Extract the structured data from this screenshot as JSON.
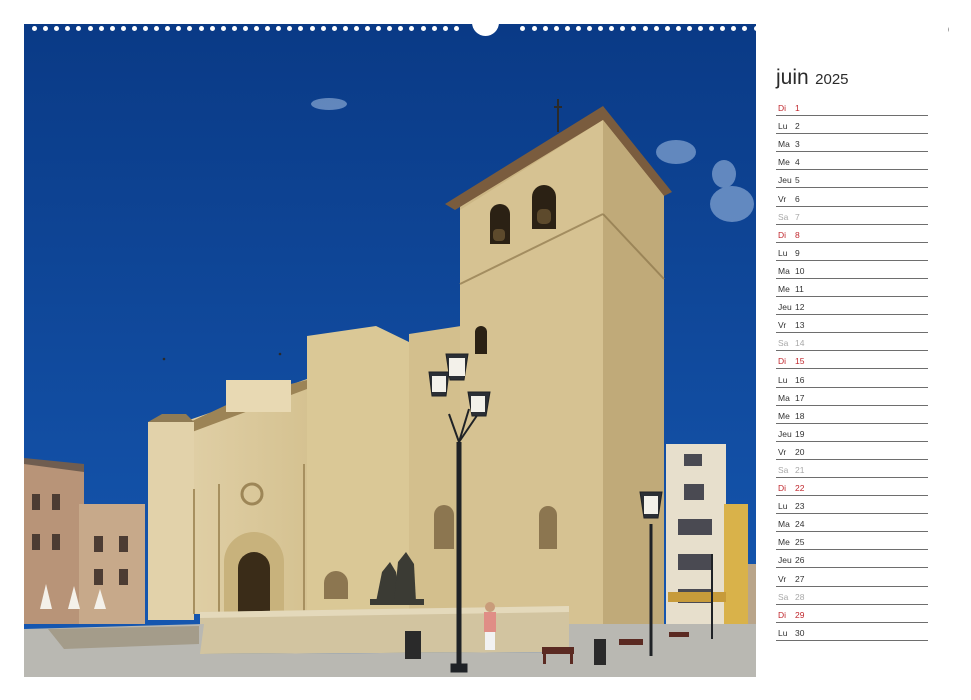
{
  "image": {
    "subject": "photo",
    "colors": {
      "sky": "#0b3f8f",
      "stone": "#d9c79d",
      "pavement": "#b8b7b2"
    }
  },
  "calendar": {
    "month": "juin",
    "year": "2025",
    "colors": {
      "weekday": "#333333",
      "saturday": "#a8a8a8",
      "sunday": "#c0272d",
      "rule": "#6e6e6e"
    },
    "days": [
      {
        "name": "Di",
        "num": "1",
        "kind": "sun"
      },
      {
        "name": "Lu",
        "num": "2",
        "kind": "week"
      },
      {
        "name": "Ma",
        "num": "3",
        "kind": "week"
      },
      {
        "name": "Me",
        "num": "4",
        "kind": "week"
      },
      {
        "name": "Jeu",
        "num": "5",
        "kind": "week"
      },
      {
        "name": "Vr",
        "num": "6",
        "kind": "week"
      },
      {
        "name": "Sa",
        "num": "7",
        "kind": "sat"
      },
      {
        "name": "Di",
        "num": "8",
        "kind": "sun"
      },
      {
        "name": "Lu",
        "num": "9",
        "kind": "week"
      },
      {
        "name": "Ma",
        "num": "10",
        "kind": "week"
      },
      {
        "name": "Me",
        "num": "11",
        "kind": "week"
      },
      {
        "name": "Jeu",
        "num": "12",
        "kind": "week"
      },
      {
        "name": "Vr",
        "num": "13",
        "kind": "week"
      },
      {
        "name": "Sa",
        "num": "14",
        "kind": "sat"
      },
      {
        "name": "Di",
        "num": "15",
        "kind": "sun"
      },
      {
        "name": "Lu",
        "num": "16",
        "kind": "week"
      },
      {
        "name": "Ma",
        "num": "17",
        "kind": "week"
      },
      {
        "name": "Me",
        "num": "18",
        "kind": "week"
      },
      {
        "name": "Jeu",
        "num": "19",
        "kind": "week"
      },
      {
        "name": "Vr",
        "num": "20",
        "kind": "week"
      },
      {
        "name": "Sa",
        "num": "21",
        "kind": "sat"
      },
      {
        "name": "Di",
        "num": "22",
        "kind": "sun"
      },
      {
        "name": "Lu",
        "num": "23",
        "kind": "week"
      },
      {
        "name": "Ma",
        "num": "24",
        "kind": "week"
      },
      {
        "name": "Me",
        "num": "25",
        "kind": "week"
      },
      {
        "name": "Jeu",
        "num": "26",
        "kind": "week"
      },
      {
        "name": "Vr",
        "num": "27",
        "kind": "week"
      },
      {
        "name": "Sa",
        "num": "28",
        "kind": "sat"
      },
      {
        "name": "Di",
        "num": "29",
        "kind": "sun"
      },
      {
        "name": "Lu",
        "num": "30",
        "kind": "week"
      }
    ]
  }
}
